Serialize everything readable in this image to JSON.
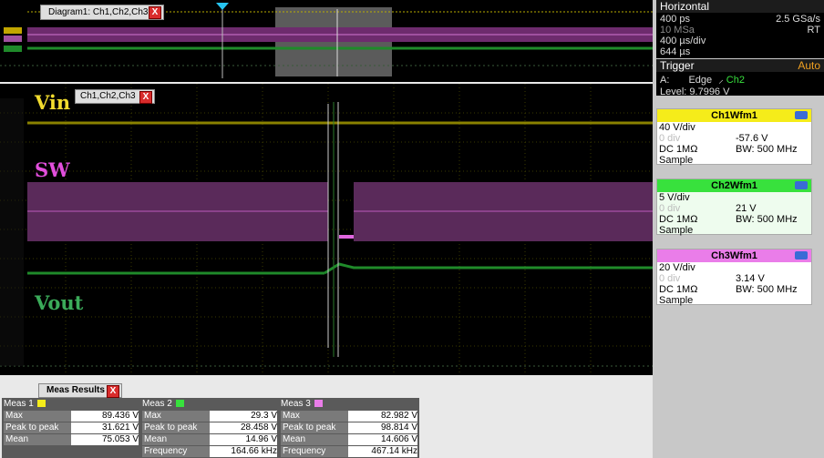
{
  "overview": {
    "tab_label": "Diagram1: Ch1,Ch2,Ch3",
    "close": "X"
  },
  "display": {
    "tab_label": "Ch1,Ch2,Ch3",
    "close": "X",
    "labels": {
      "vin": "Vin",
      "sw": "SW",
      "vout": "Vout"
    },
    "trace_colors": {
      "ch1": "#e6d800",
      "ch2": "#1f8a2a",
      "ch3": "#c040c0"
    }
  },
  "horizontal": {
    "title": "Horizontal",
    "time": "400 ps",
    "sample_rate": "2.5 GSa/s",
    "record": "10 MSa",
    "mode": "RT",
    "div": "400 µs/div",
    "window": "644 µs"
  },
  "trigger": {
    "title": "Trigger",
    "mode": "Auto",
    "source_line": "A:",
    "type": "Edge",
    "source": "Ch2",
    "level": "Level: 9.7996 V"
  },
  "ch1": {
    "title": "Ch1Wfm1",
    "scale": "40 V/div",
    "pos": "0 div",
    "offset": "-57.6 V",
    "coupling": "DC 1MΩ",
    "bw": "BW: 500 MHz",
    "mode": "Sample",
    "color": "#f5ec1a"
  },
  "ch2": {
    "title": "Ch2Wfm1",
    "scale": "5 V/div",
    "pos": "0 div",
    "offset": "21 V",
    "coupling": "DC 1MΩ",
    "bw": "BW: 500 MHz",
    "mode": "Sample",
    "color": "#38e13d"
  },
  "ch3": {
    "title": "Ch3Wfm1",
    "scale": "20 V/div",
    "pos": "0 div",
    "offset": "3.14 V",
    "coupling": "DC 1MΩ",
    "bw": "BW: 500 MHz",
    "mode": "Sample",
    "color": "#ea7de9"
  },
  "meas": {
    "tab_label": "Meas Results",
    "close": "X",
    "groups": [
      {
        "title": "Meas 1",
        "rows": [
          [
            "Max",
            "89.436 V"
          ],
          [
            "Peak to peak",
            "31.621 V"
          ],
          [
            "Mean",
            "75.053 V"
          ]
        ]
      },
      {
        "title": "Meas 2",
        "rows": [
          [
            "Max",
            "29.3 V"
          ],
          [
            "Peak to peak",
            "28.458 V"
          ],
          [
            "Mean",
            "14.96 V"
          ],
          [
            "Frequency",
            "164.66 kHz"
          ]
        ]
      },
      {
        "title": "Meas 3",
        "rows": [
          [
            "Max",
            "82.982 V"
          ],
          [
            "Peak to peak",
            "98.814 V"
          ],
          [
            "Mean",
            "14.606 V"
          ],
          [
            "Frequency",
            "467.14 kHz"
          ]
        ]
      }
    ]
  }
}
